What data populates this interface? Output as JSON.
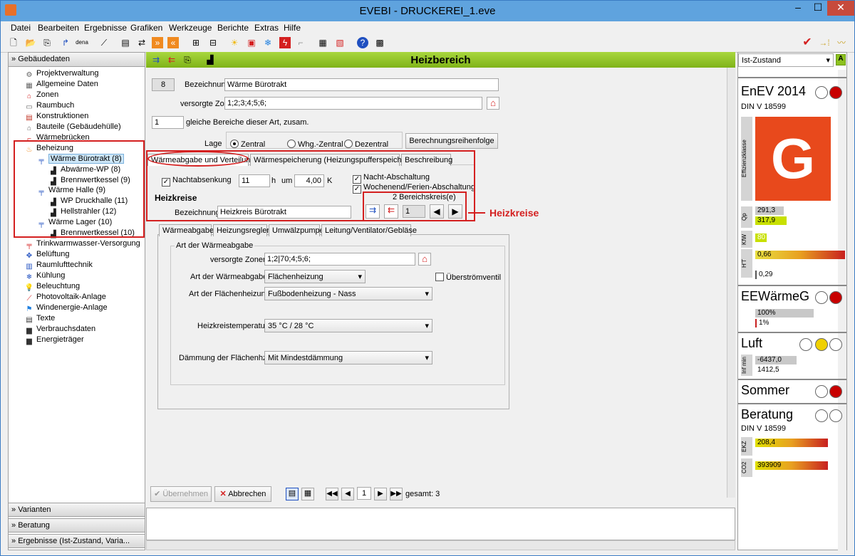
{
  "window": {
    "title": "EVEBI - DRUCKEREI_1.eve",
    "min": "–",
    "max": "☐",
    "close": "✕"
  },
  "menu": [
    "Datei",
    "Bearbeiten",
    "Ergebnisse",
    "Grafiken",
    "Werkzeuge",
    "Berichte",
    "Extras",
    "Hilfe"
  ],
  "toolbar": {
    "dena_label": "dena"
  },
  "left": {
    "header": "Gebäudedaten",
    "tree": [
      "Projektverwaltung",
      "Allgemeine Daten",
      "Zonen",
      "Raumbuch",
      "Konstruktionen",
      "Bauteile (Gebäudehülle)",
      "Wärmebrücken",
      "Beheizung",
      "Wärme Bürotrakt (8)",
      "Abwärme-WP (8)",
      "Brennwertkessel (9)",
      "Wärme Halle (9)",
      "WP Druckhalle (11)",
      "Hellstrahler (12)",
      "Wärme Lager (10)",
      "Brennwertkessel (10)",
      "Trinkwarmwasser-Versorgung",
      "Belüftung",
      "Raumlufttechnik",
      "Kühlung",
      "Beleuchtung",
      "Photovoltaik-Anlage",
      "Windenergie-Anlage",
      "Texte",
      "Verbrauchsdaten",
      "Energieträger"
    ],
    "bottom": [
      "Varianten",
      "Beratung",
      "Ergebnisse (Ist-Zustand, Varia..."
    ]
  },
  "center": {
    "title": "Heizbereich",
    "id": "8",
    "bez_label": "Bezeichnung",
    "bez_value": "Wärme Bürotrakt",
    "zonen_label": "versorgte Zonen",
    "zonen_value": "1;2;3;4;5;6;",
    "count_value": "1",
    "count_label": "gleiche Bereiche dieser Art, zusam.",
    "lage_label": "Lage",
    "lage_options": [
      "Zentral",
      "Whg.-Zentral",
      "Dezentral"
    ],
    "calc_btn": "Berechnungsreihenfolge",
    "tabs": [
      "Wärmeabgabe und Verteilung",
      "Wärmespeicherung (Heizungspufferspeicher)",
      "Beschreibung"
    ],
    "nacht_label": "Nachtabsenkung",
    "nacht_value": "11",
    "h_label": "h",
    "um_label": "um",
    "k_value": "4,00",
    "k_label": "K",
    "nacht_ab": "Nacht-Abschaltung",
    "wochenend": "Wochenend/Ferien-Abschaltung",
    "heizkreise": "Heizkreise",
    "bereichskreis": "2 Bereichskreis(e)",
    "hk_bez_label": "Bezeichnung",
    "hk_bez_value": "Heizkreis Bürotrakt",
    "hk_index": "1",
    "callout": "Heizkreise",
    "subtabs": [
      "Wärmeabgabe",
      "Heizungsregler",
      "Umwälzpumpe",
      "Leitung/Ventilator/Gebläse"
    ],
    "group_title": "Art der Wärmeabgabe",
    "sub_zonen_label": "versorgte Zonen",
    "sub_zonen_value": "1;2|70;4;5;6;",
    "art_label": "Art der Wärmeabgabe",
    "art_value": "Flächenheizung",
    "ueber": "Überströmventil",
    "flaeche_label": "Art der Flächenheizung",
    "flaeche_value": "Fußbodenheizung - Nass",
    "temp_label": "Heizkreistemperatur",
    "temp_value": "35 °C / 28 °C",
    "daemm_label": "Dämmung der Flächenhzg.",
    "daemm_value": "Mit Mindestdämmung",
    "uebernehmen": "Übernehmen",
    "abbrechen": "Abbrechen",
    "page": "1",
    "gesamt": "gesamt: 3"
  },
  "right": {
    "state": "Ist-Zustand",
    "state_icon": "A",
    "enev": "EnEV 2014",
    "din": "DIN V 18599",
    "effizienz": "Effizienzklasse",
    "grade": "G",
    "qp_label": "Qp",
    "qp1": "291,3",
    "qp2": "317,9",
    "kw_label": "KfW",
    "kw": "80",
    "ht_label": "H'T",
    "ht1": "0,66",
    "ht2": "0,29",
    "eew": "EEWärmeG",
    "eew1": "100%",
    "eew2": "1%",
    "luft": "Luft",
    "inf_label": "Inf min",
    "luft1": "-6437,0",
    "luft2": "1412,5",
    "sommer": "Sommer",
    "beratung": "Beratung",
    "din2": "DIN V 18599",
    "ekz_label": "EKZ",
    "ekz": "208,4",
    "co2_label": "CO2",
    "co2": "393909"
  },
  "colors": {
    "accent": "#8dc21f",
    "red": "#d42020",
    "grade_bg": "#e8491c"
  }
}
